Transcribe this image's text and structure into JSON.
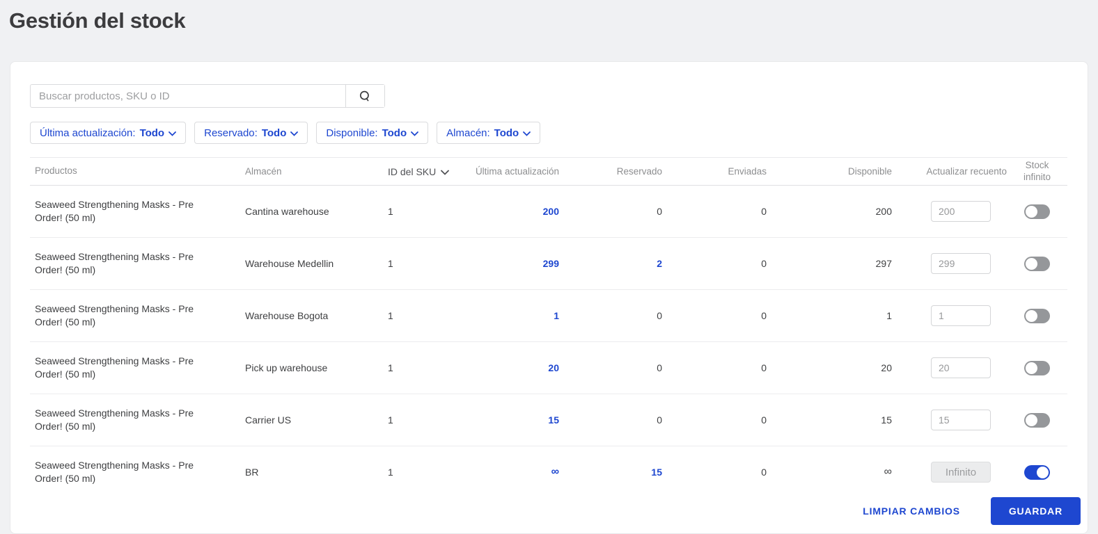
{
  "page": {
    "title": "Gestión del stock"
  },
  "search": {
    "placeholder": "Buscar productos, SKU o ID",
    "value": ""
  },
  "filters": [
    {
      "label": "Última actualización:",
      "value": "Todo"
    },
    {
      "label": "Reservado:",
      "value": "Todo"
    },
    {
      "label": "Disponible:",
      "value": "Todo"
    },
    {
      "label": "Almacén:",
      "value": "Todo"
    }
  ],
  "table": {
    "headers": {
      "products": "Productos",
      "warehouse": "Almacén",
      "sku_id": "ID del SKU",
      "last_update": "Última actualización",
      "reserved": "Reservado",
      "shipped": "Enviadas",
      "available": "Disponible",
      "update_count": "Actualizar recuento",
      "infinite_stock": "Stock infinito"
    },
    "rows": [
      {
        "product": "Seaweed Strengthening Masks - Pre Order! (50 ml)",
        "warehouse": "Cantina warehouse",
        "sku_id": "1",
        "last_update": "200",
        "reserved": "0",
        "shipped": "0",
        "available": "200",
        "update_count": "200",
        "stock_infinito": false
      },
      {
        "product": "Seaweed Strengthening Masks - Pre Order! (50 ml)",
        "warehouse": "Warehouse Medellin",
        "sku_id": "1",
        "last_update": "299",
        "reserved": "2",
        "shipped": "0",
        "available": "297",
        "update_count": "299",
        "stock_infinito": false
      },
      {
        "product": "Seaweed Strengthening Masks - Pre Order! (50 ml)",
        "warehouse": "Warehouse Bogota",
        "sku_id": "1",
        "last_update": "1",
        "reserved": "0",
        "shipped": "0",
        "available": "1",
        "update_count": "1",
        "stock_infinito": false
      },
      {
        "product": "Seaweed Strengthening Masks - Pre Order! (50 ml)",
        "warehouse": "Pick up warehouse",
        "sku_id": "1",
        "last_update": "20",
        "reserved": "0",
        "shipped": "0",
        "available": "20",
        "update_count": "20",
        "stock_infinito": false
      },
      {
        "product": "Seaweed Strengthening Masks - Pre Order! (50 ml)",
        "warehouse": "Carrier US",
        "sku_id": "1",
        "last_update": "15",
        "reserved": "0",
        "shipped": "0",
        "available": "15",
        "update_count": "15",
        "stock_infinito": false
      },
      {
        "product": "Seaweed Strengthening Masks - Pre Order! (50 ml)",
        "warehouse": "BR",
        "sku_id": "1",
        "last_update": "∞",
        "reserved": "15",
        "shipped": "0",
        "available": "∞",
        "update_count": "Infinito",
        "stock_infinito": true
      }
    ]
  },
  "footer": {
    "clear_label": "LIMPIAR CAMBIOS",
    "save_label": "GUARDAR"
  },
  "colors": {
    "accent": "#1e47d0",
    "page-bg": "#f0f1f3",
    "toggle-off": "#95979a"
  }
}
